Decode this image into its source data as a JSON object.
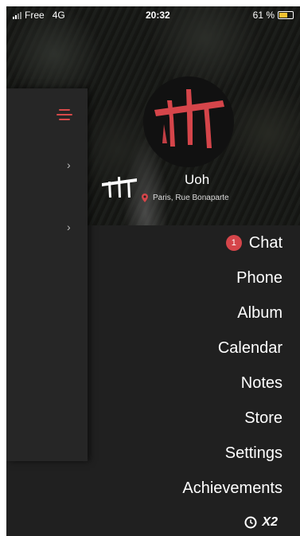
{
  "status_bar": {
    "carrier": "Free",
    "network": "4G",
    "time": "20:32",
    "battery_percent": "61 %",
    "battery_level": 0.61
  },
  "profile": {
    "name": "Uoh",
    "location": "Paris, Rue Bonaparte"
  },
  "menu": {
    "items": [
      {
        "label": "Chat",
        "badge": "1"
      },
      {
        "label": "Phone"
      },
      {
        "label": "Album"
      },
      {
        "label": "Calendar"
      },
      {
        "label": "Notes"
      },
      {
        "label": "Store"
      },
      {
        "label": "Settings"
      },
      {
        "label": "Achievements"
      }
    ]
  },
  "footer": {
    "multiplier": "X2"
  },
  "colors": {
    "accent": "#d5454a",
    "background": "#202020",
    "drawer": "#262626",
    "battery": "#f1c232"
  },
  "icons": {
    "menu": "hamburger-icon",
    "chevron": "chevron-right-icon",
    "location": "location-pin-icon",
    "clock": "clock-icon",
    "logo": "triple-t-logo"
  }
}
